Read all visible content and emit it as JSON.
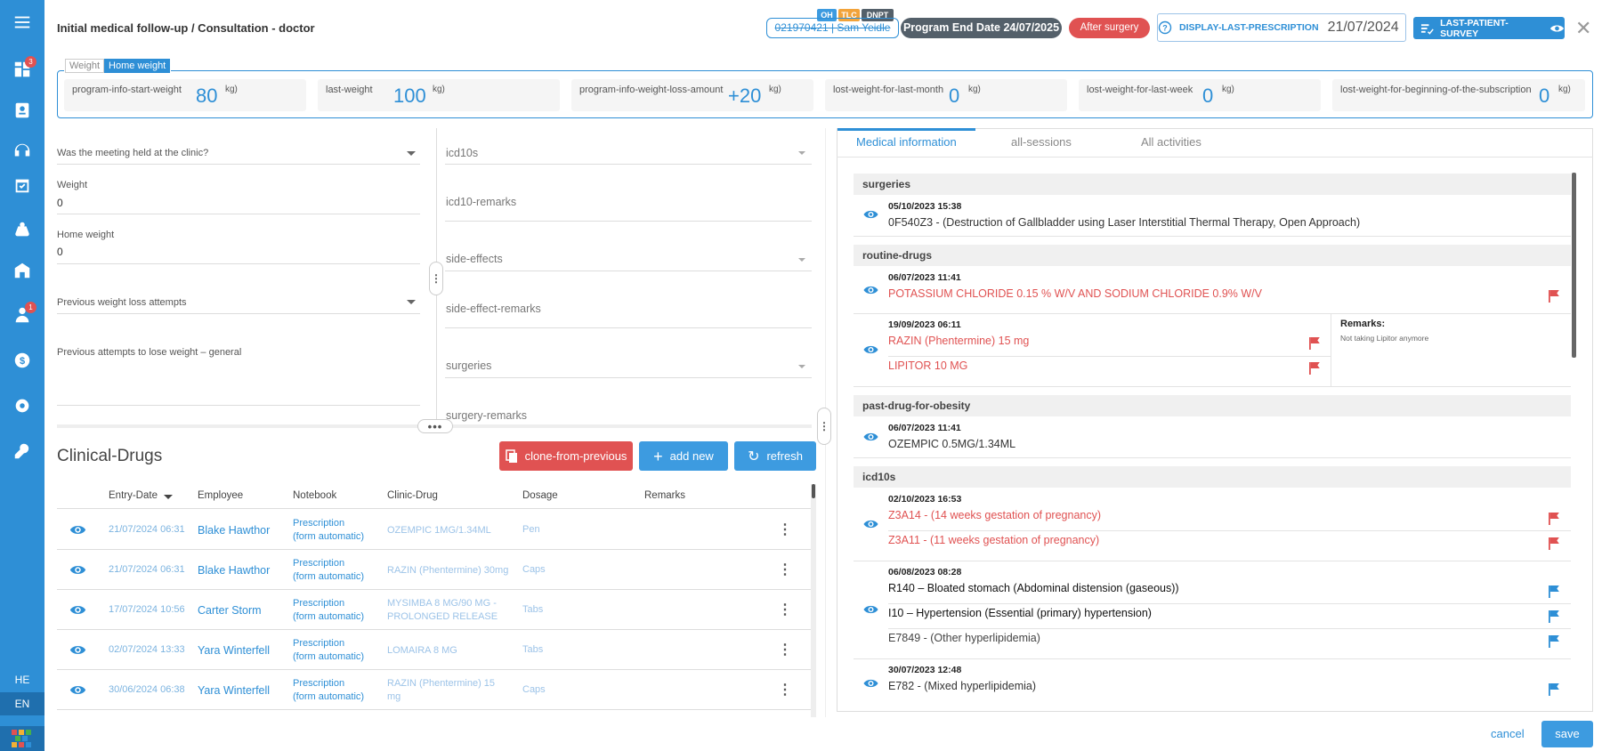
{
  "header": {
    "title": "Initial medical follow-up / Consultation - doctor",
    "patient": "021970421 | Sam Yeidle",
    "badges": [
      "OH",
      "TLC",
      "DNPT"
    ],
    "program_end": "Program End Date 24/07/2025",
    "status": "After surgery",
    "display_last_prescription_label": "DISPLAY-LAST-PRESCRIPTION",
    "display_last_prescription_date": "21/07/2024",
    "last_patient_survey": "LAST-PATIENT-SURVEY"
  },
  "sidebar": {
    "badges": [
      "3",
      "1"
    ],
    "languages": [
      "HE",
      "EN"
    ],
    "active_language": "EN"
  },
  "weight": {
    "tabs": [
      "Weight",
      "Home weight"
    ],
    "cards": [
      {
        "label": "program-info-start-weight",
        "value": "80",
        "unit": "kg)"
      },
      {
        "label": "last-weight",
        "value": "100",
        "unit": "kg)"
      },
      {
        "label": "program-info-weight-loss-amount",
        "value": "+20",
        "unit": "kg)"
      },
      {
        "label": "lost-weight-for-last-month",
        "value": "0",
        "unit": "kg)"
      },
      {
        "label": "lost-weight-for-last-week",
        "value": "0",
        "unit": "kg)"
      },
      {
        "label": "lost-weight-for-beginning-of-the-subscription",
        "value": "0",
        "unit": "kg)"
      }
    ]
  },
  "form_left": {
    "meeting_clinic": "Was the meeting held at the clinic?",
    "weight_label": "Weight",
    "weight_value": "0",
    "home_weight_label": "Home weight",
    "home_weight_value": "0",
    "prev_attempts": "Previous weight loss attempts",
    "prev_attempts_general": "Previous attempts to lose weight – general"
  },
  "form_mid": {
    "icd10s": "icd10s",
    "icd10_remarks": "icd10-remarks",
    "side_effects": "side-effects",
    "side_effect_remarks": "side-effect-remarks",
    "surgeries": "surgeries",
    "surgery_remarks": "surgery-remarks"
  },
  "clinical_drugs": {
    "title": "Clinical-Drugs",
    "clone_btn": "clone-from-previous",
    "add_btn": "add new",
    "refresh_btn": "refresh",
    "columns": [
      "Entry-Date",
      "Employee",
      "Notebook",
      "Clinic-Drug",
      "Dosage",
      "Remarks"
    ],
    "rows": [
      {
        "date": "21/07/2024 06:31",
        "employee": "Blake Hawthor",
        "notebook": [
          "Prescription",
          "(form automatic)"
        ],
        "drug": [
          "OZEMPIC 1MG/1.34ML"
        ],
        "dosage": "Pen"
      },
      {
        "date": "21/07/2024 06:31",
        "employee": "Blake Hawthor",
        "notebook": [
          "Prescription",
          "(form automatic)"
        ],
        "drug": [
          "RAZIN (Phentermine) 30mg"
        ],
        "dosage": "Caps"
      },
      {
        "date": "17/07/2024 10:56",
        "employee": "Carter Storm",
        "notebook": [
          "Prescription",
          "(form automatic)"
        ],
        "drug": [
          "MYSIMBA 8 MG/90 MG -",
          "PROLONGED RELEASE"
        ],
        "dosage": "Tabs"
      },
      {
        "date": "02/07/2024 13:33",
        "employee": "Yara Winterfell",
        "notebook": [
          "Prescription",
          "(form automatic)"
        ],
        "drug": [
          "LOMAIRA 8 MG"
        ],
        "dosage": "Tabs"
      },
      {
        "date": "30/06/2024 06:38",
        "employee": "Yara Winterfell",
        "notebook": [
          "Prescription",
          "(form automatic)"
        ],
        "drug": [
          "RAZIN (Phentermine) 15",
          "mg"
        ],
        "dosage": "Caps"
      }
    ]
  },
  "right": {
    "tabs": [
      "Medical information",
      "all-sessions",
      "All activities"
    ],
    "sections": {
      "surgeries": {
        "title": "surgeries",
        "date": "05/10/2023 15:38",
        "text": "0F540Z3 - (Destruction of Gallbladder using Laser Interstitial Thermal Therapy, Open Approach)"
      },
      "routine": {
        "title": "routine-drugs",
        "e1_date": "06/07/2023 11:41",
        "e1_text": "POTASSIUM CHLORIDE 0.15 % W/V AND SODIUM CHLORIDE 0.9% W/V",
        "e2_date": "19/09/2023 06:11",
        "e2_text1": "RAZIN (Phentermine) 15 mg",
        "e2_text2": "LIPITOR 10 MG",
        "remarks_label": "Remarks:",
        "remarks_text": "Not taking Lipitor anymore"
      },
      "past": {
        "title": "past-drug-for-obesity",
        "date": "06/07/2023 11:41",
        "text": "OZEMPIC 0.5MG/1.34ML"
      },
      "icd": {
        "title": "icd10s",
        "e1_date": "02/10/2023 16:53",
        "e1_text1": "Z3A14 - (14 weeks gestation of pregnancy)",
        "e1_text2": "Z3A11 - (11 weeks gestation of pregnancy)",
        "e2_date": "06/08/2023 08:28",
        "e2_text1": "R140 – Bloated stomach (Abdominal distension (gaseous))",
        "e2_text2": "I10 – Hypertension (Essential (primary) hypertension)",
        "e2_text3": "E7849 - (Other hyperlipidemia)",
        "e3_date": "30/07/2023 12:48",
        "e3_text": "E782 - (Mixed hyperlipidemia)"
      }
    }
  },
  "footer": {
    "cancel": "cancel",
    "save": "save"
  },
  "colors": {
    "primary": "#2e8fd6",
    "danger": "#e05252",
    "dark": "#54606a"
  }
}
